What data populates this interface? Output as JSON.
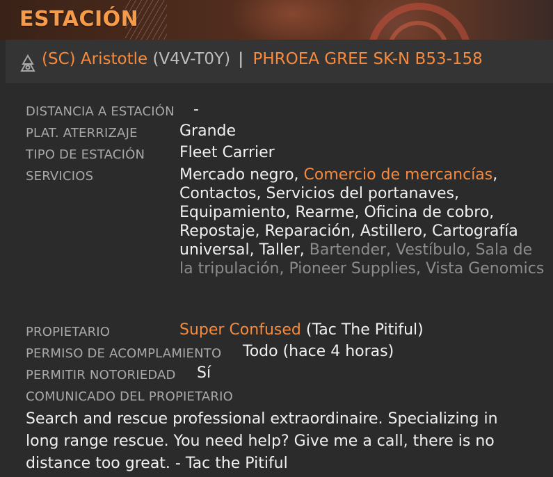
{
  "header": {
    "title": "ESTACIÓN"
  },
  "station": {
    "icon": "fleet-carrier-icon",
    "name": "(SC) Aristotle",
    "callsign": "(V4V-T0Y)",
    "separator": "|",
    "system": "PHROEA GREE SK-N B53-158"
  },
  "details": {
    "distance_label": "DISTANCIA A ESTACIÓN",
    "distance_value": "-",
    "pad_label": "PLAT. ATERRIZAJE",
    "pad_value": "Grande",
    "type_label": "TIPO DE ESTACIÓN",
    "type_value": "Fleet Carrier",
    "services_label": "SERVICIOS",
    "services": [
      {
        "text": "Mercado negro",
        "state": "normal"
      },
      {
        "text": "Comercio de mercancías",
        "state": "highlight"
      },
      {
        "text": "Contactos",
        "state": "normal"
      },
      {
        "text": "Servicios del portanaves",
        "state": "normal"
      },
      {
        "text": "Equipamiento",
        "state": "normal"
      },
      {
        "text": "Rearme",
        "state": "normal"
      },
      {
        "text": "Oficina de cobro",
        "state": "normal"
      },
      {
        "text": "Repostaje",
        "state": "normal"
      },
      {
        "text": "Reparación",
        "state": "normal"
      },
      {
        "text": "Astillero",
        "state": "normal"
      },
      {
        "text": "Cartografía universal",
        "state": "normal"
      },
      {
        "text": "Taller",
        "state": "normal"
      },
      {
        "text": "Bartender",
        "state": "dim"
      },
      {
        "text": "Vestíbulo",
        "state": "dim"
      },
      {
        "text": "Sala de la tripulación",
        "state": "dim"
      },
      {
        "text": "Pioneer Supplies",
        "state": "dim"
      },
      {
        "text": "Vista Genomics",
        "state": "dim"
      }
    ],
    "owner_label": "PROPIETARIO",
    "owner_name": "Super Confused",
    "owner_suffix": "(Tac The Pitiful)",
    "docking_label": "PERMISO DE ACOMPLAMIENTO",
    "docking_value": "Todo (hace 4 horas)",
    "notoriety_label": "PERMITIR NOTORIEDAD",
    "notoriety_value": "Sí",
    "message_label": "COMUNICADO DEL PROPIETARIO",
    "message_text": "Search and rescue professional extraordinaire. Specializing in long range rescue. You need help? Give me a call, there is no distance too great. - Tac the Pitiful"
  },
  "colors": {
    "accent": "#f78a3c",
    "title": "#f59b4a",
    "label": "#a9a9a9",
    "dim": "#8c8c8c"
  }
}
